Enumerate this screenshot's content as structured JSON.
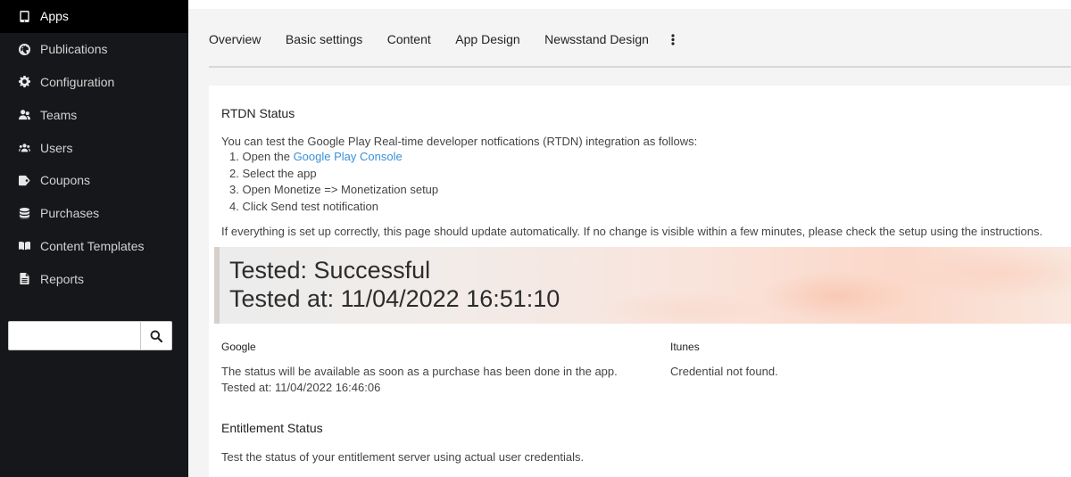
{
  "sidebar": {
    "items": [
      {
        "label": "Apps",
        "icon": "tablet-icon",
        "active": true
      },
      {
        "label": "Publications",
        "icon": "globe-icon"
      },
      {
        "label": "Configuration",
        "icon": "gear-icon"
      },
      {
        "label": "Teams",
        "icon": "team-icon"
      },
      {
        "label": "Users",
        "icon": "users-icon"
      },
      {
        "label": "Coupons",
        "icon": "tag-icon"
      },
      {
        "label": "Purchases",
        "icon": "database-icon"
      },
      {
        "label": "Content Templates",
        "icon": "book-icon"
      },
      {
        "label": "Reports",
        "icon": "document-icon"
      }
    ],
    "search": {
      "value": "",
      "placeholder": ""
    }
  },
  "tabs": [
    "Overview",
    "Basic settings",
    "Content",
    "App Design",
    "Newsstand Design"
  ],
  "rtdn": {
    "title": "RTDN Status",
    "intro": "You can test the Google Play Real-time developer notfications (RTDN) integration as follows:",
    "step1_prefix": "1. Open the ",
    "step1_link": "Google Play Console",
    "step2": "2. Select the app",
    "step3": "3. Open Monetize => Monetization setup",
    "step4": "4. Click Send test notification",
    "note": "If everything is set up correctly, this page should update automatically. If no change is visible within a few minutes, please check the setup using the instructions.",
    "result_status": "Tested: Successful",
    "result_time": "Tested at: 11/04/2022 16:51:10"
  },
  "google": {
    "heading": "Google",
    "status": "The status will be available as soon as a purchase has been done in the app.",
    "tested_at": "Tested at: 11/04/2022 16:46:06"
  },
  "itunes": {
    "heading": "Itunes",
    "status": "Credential not found."
  },
  "entitlement": {
    "title": "Entitlement Status",
    "description": "Test the status of your entitlement server using actual user credentials."
  },
  "colors": {
    "sidebar_bg": "#16171a",
    "active_bg": "#000000",
    "link": "#3a8fd8",
    "result_highlight": "#fbd8c9"
  }
}
